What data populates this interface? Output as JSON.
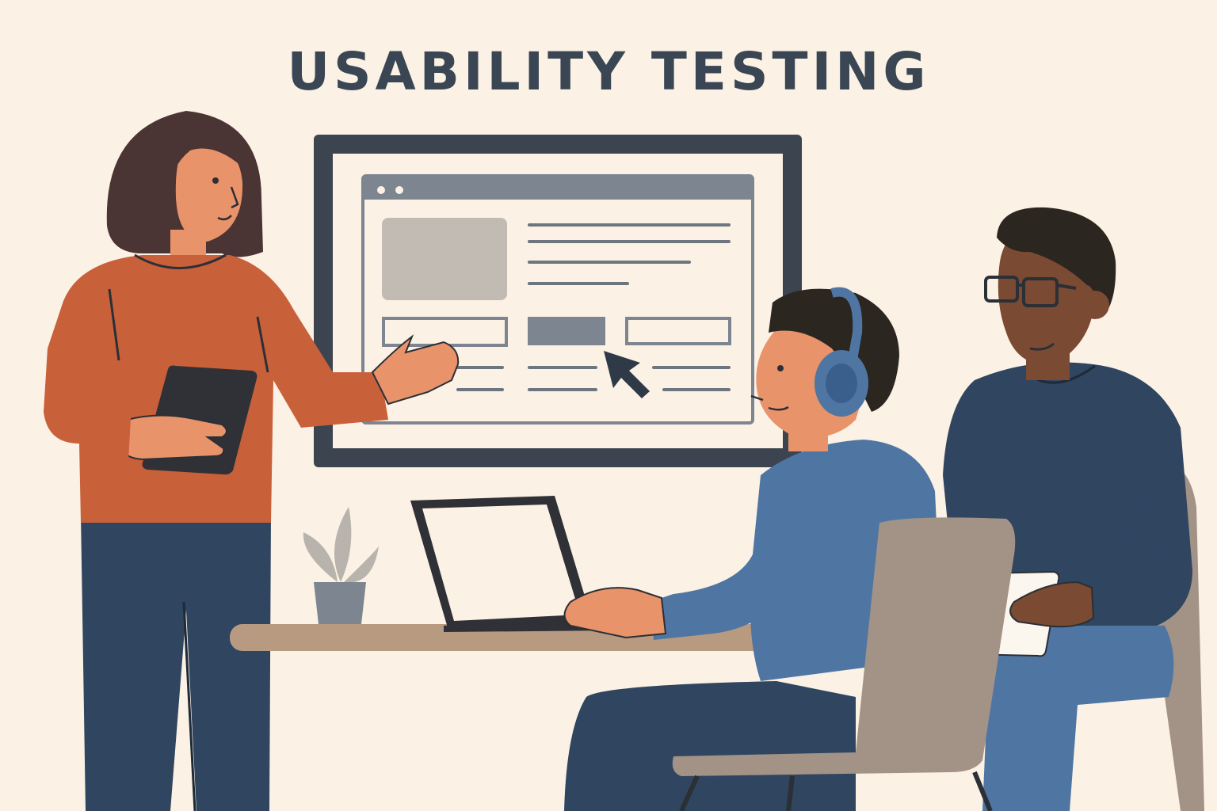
{
  "title": "USABILITY TESTING",
  "palette": {
    "background": "#fbf1e4",
    "ink": "#2b2f36",
    "sweater_orange": "#c8603a",
    "navy": "#2f4560",
    "blue": "#4f76a3",
    "skin_light": "#e8936a",
    "skin_dark": "#7a4a32",
    "chair": "#a39387",
    "table": "#b89a80",
    "monitor_frame": "#3c4450",
    "wireframe_gray": "#7d8590"
  },
  "scene": {
    "people": [
      {
        "role": "facilitator",
        "holding": "tablet",
        "gesture": "pointing-at-screen"
      },
      {
        "role": "participant",
        "wearing": "headphones",
        "using": "laptop"
      },
      {
        "role": "observer",
        "wearing": "glasses",
        "holding": "notepad"
      }
    ],
    "objects": [
      "wall-monitor",
      "website-wireframe",
      "mouse-cursor",
      "laptop",
      "potted-plant",
      "table",
      "chair"
    ]
  }
}
